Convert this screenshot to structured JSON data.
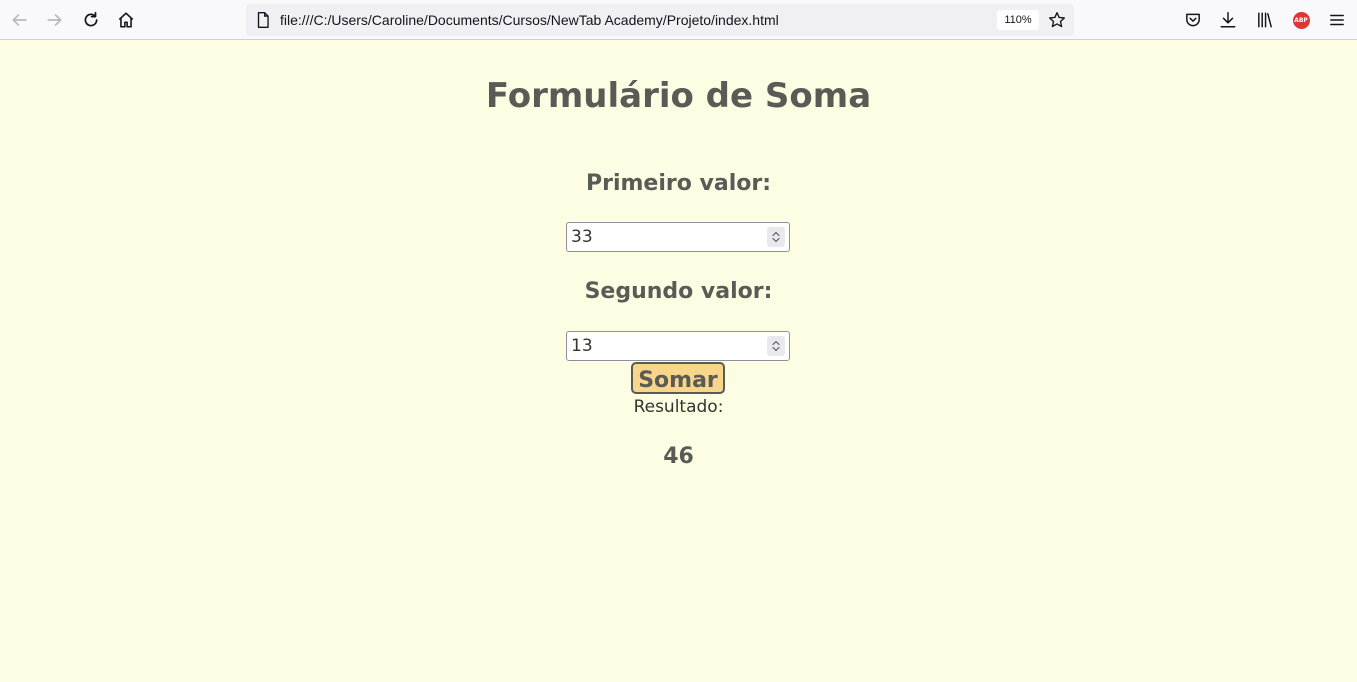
{
  "browser": {
    "url": "file:///C:/Users/Caroline/Documents/Cursos/NewTab Academy/Projeto/index.html",
    "zoom": "110%",
    "icons": [
      "back-icon",
      "forward-icon",
      "reload-icon",
      "home-icon",
      "page-icon",
      "bookmark-star-icon",
      "pocket-icon",
      "downloads-icon",
      "library-icon",
      "adblock-plus-icon",
      "menu-icon"
    ],
    "abp_text": "ABP"
  },
  "page": {
    "title": "Formulário de Soma",
    "first_label": "Primeiro valor:",
    "first_value": "33",
    "second_label": "Segundo valor:",
    "second_value": "13",
    "button_label": "Somar",
    "result_label": "Resultado:",
    "result_value": "46"
  },
  "colors": {
    "page_background": "#fdfde3",
    "text": "#5b5b56",
    "button_background": "#f7d58a"
  }
}
